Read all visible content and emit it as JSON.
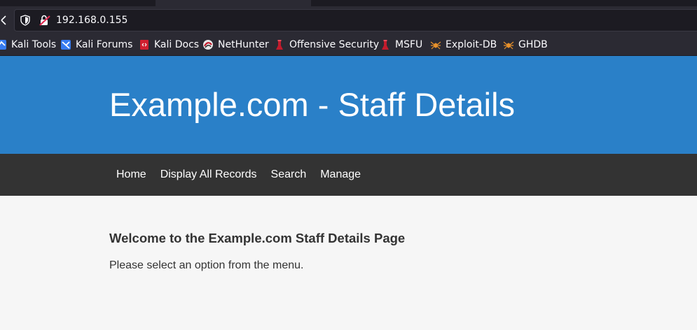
{
  "browser": {
    "url": "192.168.0.155",
    "bookmarks": [
      {
        "label": "Kali Tools",
        "icon": "kali-dragon-icon"
      },
      {
        "label": "Kali Forums",
        "icon": "kali-dragon-icon"
      },
      {
        "label": "Kali Docs",
        "icon": "docs-icon"
      },
      {
        "label": "NetHunter",
        "icon": "nethunter-icon"
      },
      {
        "label": "Offensive Security",
        "icon": "offsec-icon"
      },
      {
        "label": "MSFU",
        "icon": "offsec-icon"
      },
      {
        "label": "Exploit-DB",
        "icon": "spider-icon"
      },
      {
        "label": "GHDB",
        "icon": "spider-icon"
      }
    ]
  },
  "site": {
    "title": "Example.com - Staff Details",
    "nav": [
      "Home",
      "Display All Records",
      "Search",
      "Manage"
    ],
    "welcome_heading": "Welcome to the Example.com Staff Details Page",
    "welcome_text": "Please select an option from the menu."
  },
  "colors": {
    "header_bg": "#2a80c8",
    "nav_bg": "#333333",
    "page_bg": "#f6f6f6",
    "chrome_bg": "#2b2a33"
  }
}
